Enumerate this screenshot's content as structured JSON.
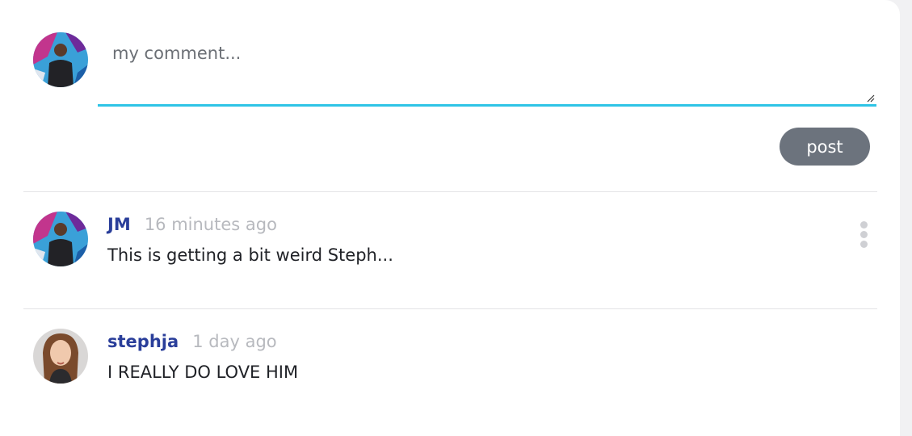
{
  "composer": {
    "placeholder": "my comment...",
    "value": "",
    "post_label": "post",
    "accent_color": "#2ec4e6"
  },
  "comments": [
    {
      "author": "JM",
      "timestamp": "16 minutes ago",
      "text": "This is getting a bit weird Steph...",
      "has_menu": true
    },
    {
      "author": "stephja",
      "timestamp": "1 day ago",
      "text": "I REALLY DO LOVE HIM",
      "has_menu": false
    }
  ],
  "icons": {
    "menu": "kebab-menu-icon",
    "resize": "resize-handle-icon"
  },
  "colors": {
    "author": "#2a3e9a",
    "timestamp": "#b7b9be",
    "post_button": "#6c737d"
  }
}
